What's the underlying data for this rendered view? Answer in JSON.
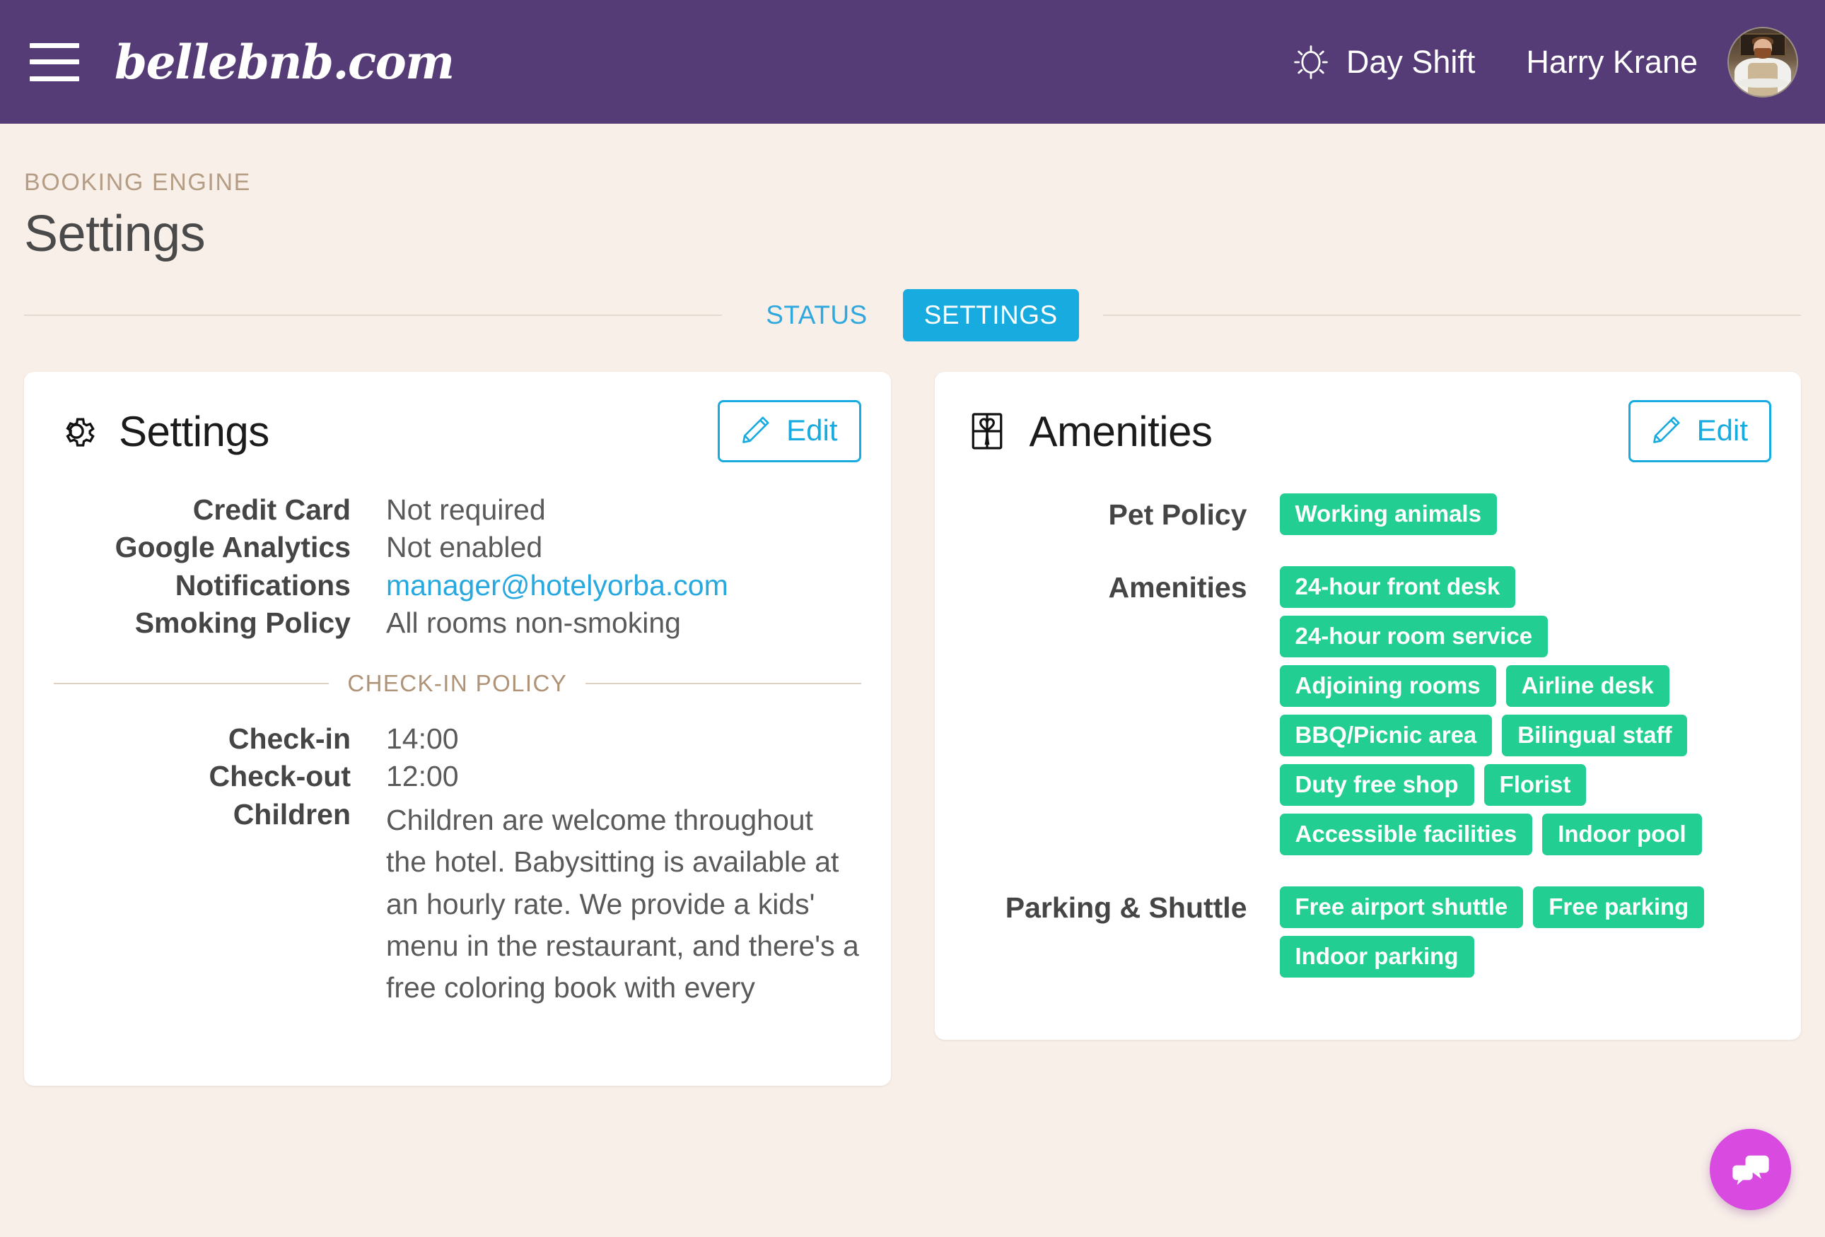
{
  "topbar": {
    "brand": "bellebnb.com",
    "shift_label": "Day Shift",
    "user_name": "Harry Krane"
  },
  "breadcrumb": "BOOKING ENGINE",
  "page_title": "Settings",
  "tabs": [
    {
      "label": "STATUS",
      "active": false
    },
    {
      "label": "SETTINGS",
      "active": true
    }
  ],
  "settings_card": {
    "title": "Settings",
    "edit_label": "Edit",
    "rows": [
      {
        "label": "Credit Card",
        "value": "Not required",
        "link": false
      },
      {
        "label": "Google Analytics",
        "value": "Not enabled",
        "link": false
      },
      {
        "label": "Notifications",
        "value": "manager@hotelyorba.com",
        "link": true
      },
      {
        "label": "Smoking Policy",
        "value": "All rooms non-smoking",
        "link": false
      }
    ],
    "section_caption": "CHECK-IN POLICY",
    "policy_rows": [
      {
        "label": "Check-in",
        "value": "14:00"
      },
      {
        "label": "Check-out",
        "value": "12:00"
      },
      {
        "label": "Children",
        "value": "Children are welcome throughout the hotel. Babysitting is available at an hourly rate. We provide a kids' menu in the restaurant, and there's a free coloring book with every"
      }
    ]
  },
  "amenities_card": {
    "title": "Amenities",
    "edit_label": "Edit",
    "groups": [
      {
        "label": "Pet Policy",
        "tags": [
          "Working animals"
        ]
      },
      {
        "label": "Amenities",
        "tags": [
          "24-hour front desk",
          "24-hour room service",
          "Adjoining rooms",
          "Airline desk",
          "BBQ/Picnic area",
          "Bilingual staff",
          "Duty free shop",
          "Florist",
          "Accessible facilities",
          "Indoor pool"
        ]
      },
      {
        "label": "Parking & Shuttle",
        "tags": [
          "Free airport shuttle",
          "Free parking",
          "Indoor parking"
        ]
      }
    ]
  },
  "chat_fab": {
    "name": "chat-button"
  },
  "colors": {
    "header_purple": "#553c76",
    "page_background": "#f8efe9",
    "accent_blue": "#17abdf",
    "tag_green": "#23ce92",
    "crumb_brown": "#b59d85",
    "fab_magenta": "#d94ae0"
  }
}
